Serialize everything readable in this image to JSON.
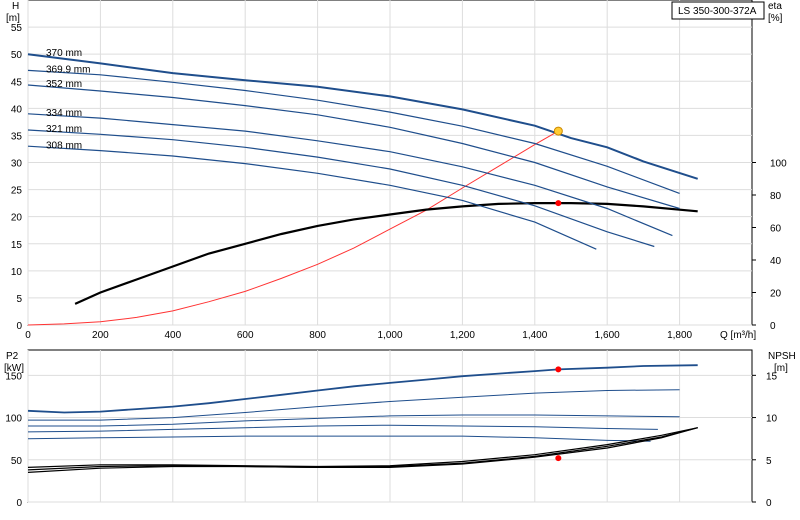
{
  "chart_data": [
    {
      "type": "line",
      "model_label": "LS 350-300-372A",
      "ylabel_left": "H",
      "ylabel_left_unit": "[m]",
      "ylabel_right": "eta",
      "ylabel_right_unit": "[%]",
      "xlabel": "Q [m³/h]",
      "xlim": [
        0,
        2000
      ],
      "ylim_left": [
        0,
        60
      ],
      "ylim_right": [
        0,
        200
      ],
      "x_ticks": [
        0,
        200,
        400,
        600,
        800,
        1000,
        1200,
        1400,
        1600,
        1800
      ],
      "x_tick_labels": [
        "0",
        "200",
        "400",
        "600",
        "800",
        "1,000",
        "1,200",
        "1,400",
        "1,600",
        "1,800"
      ],
      "y_ticks_left": [
        0,
        5,
        10,
        15,
        20,
        25,
        30,
        35,
        40,
        45,
        50,
        55
      ],
      "y_ticks_right": [
        0,
        20,
        40,
        60,
        80,
        100
      ],
      "grid": true,
      "colors": {
        "head": "#1f4e8c",
        "efficiency": "#000000",
        "system": "#ff3333",
        "operating_point_head": "#ffcc33",
        "operating_point": "#ff0000",
        "grid": "#dddddd"
      },
      "head_curves": [
        {
          "label": "370 mm",
          "x": [
            0,
            200,
            400,
            600,
            800,
            1000,
            1200,
            1400,
            1500,
            1600,
            1700,
            1850
          ],
          "y": [
            50,
            48.3,
            46.5,
            45.2,
            44,
            42.2,
            39.8,
            36.8,
            34.5,
            32.8,
            30.2,
            27
          ]
        },
        {
          "label": "369.9 mm",
          "x": [
            0,
            200,
            400,
            600,
            800,
            1000,
            1200,
            1400,
            1600,
            1800
          ],
          "y": [
            47,
            46.2,
            44.8,
            43.3,
            41.5,
            39.3,
            36.7,
            33.5,
            29.3,
            24.3
          ]
        },
        {
          "label": "352 mm",
          "x": [
            0,
            200,
            400,
            600,
            800,
            1000,
            1200,
            1400,
            1600,
            1800
          ],
          "y": [
            44.3,
            43.2,
            42,
            40.5,
            38.8,
            36.5,
            33.5,
            30,
            25.5,
            21.5
          ]
        },
        {
          "label": "334 mm",
          "x": [
            0,
            200,
            400,
            600,
            800,
            1000,
            1200,
            1400,
            1600,
            1780
          ],
          "y": [
            39,
            38.2,
            37,
            35.8,
            34,
            32,
            29.2,
            25.8,
            21.5,
            16.5
          ]
        },
        {
          "label": "321 mm",
          "x": [
            0,
            200,
            400,
            600,
            800,
            1000,
            1200,
            1400,
            1600,
            1730
          ],
          "y": [
            36,
            35.2,
            34.2,
            32.8,
            31,
            28.8,
            25.8,
            22,
            17.2,
            14.5
          ]
        },
        {
          "label": "308 mm",
          "x": [
            0,
            200,
            400,
            600,
            800,
            1000,
            1200,
            1400,
            1570
          ],
          "y": [
            33,
            32.2,
            31.2,
            29.8,
            28,
            25.8,
            23,
            19,
            14
          ]
        }
      ],
      "efficiency_curve": {
        "x": [
          130,
          200,
          300,
          400,
          500,
          600,
          700,
          800,
          900,
          1000,
          1100,
          1200,
          1300,
          1400,
          1500,
          1600,
          1700,
          1850
        ],
        "y": [
          13,
          20,
          28,
          36,
          44,
          50,
          56,
          61,
          65,
          68,
          71,
          73,
          74.5,
          75,
          75,
          74.5,
          73,
          70
        ]
      },
      "system_curve": {
        "x": [
          0,
          100,
          200,
          300,
          400,
          500,
          600,
          700,
          800,
          900,
          1000,
          1100,
          1200,
          1300,
          1400,
          1465
        ],
        "y": [
          0,
          0.2,
          0.6,
          1.4,
          2.6,
          4.3,
          6.2,
          8.6,
          11.2,
          14.2,
          17.7,
          21.2,
          25.3,
          29.3,
          33.3,
          35.8
        ]
      },
      "operating_point_head": {
        "x": 1465,
        "y": 35.8
      },
      "operating_point_eta": {
        "x": 1465,
        "y": 75
      }
    },
    {
      "type": "line",
      "ylabel_left": "P2",
      "ylabel_left_unit": "[kW]",
      "ylabel_right": "NPSH",
      "ylabel_right_unit": "[m]",
      "xlim": [
        0,
        2000
      ],
      "ylim_left": [
        0,
        180
      ],
      "ylim_right": [
        0,
        18
      ],
      "y_ticks_left": [
        0,
        50,
        100,
        150
      ],
      "y_ticks_right": [
        0,
        5,
        10,
        15
      ],
      "grid": true,
      "power_curves": [
        {
          "x": [
            0,
            100,
            200,
            300,
            400,
            500,
            600,
            700,
            800,
            900,
            1000,
            1100,
            1200,
            1300,
            1400,
            1465,
            1600,
            1700,
            1850
          ],
          "y": [
            108,
            106,
            107,
            110,
            113,
            117,
            122,
            127,
            132,
            137,
            141,
            145,
            149,
            152,
            155,
            157,
            159,
            161,
            162
          ]
        },
        {
          "x": [
            0,
            200,
            400,
            600,
            800,
            1000,
            1200,
            1400,
            1600,
            1800
          ],
          "y": [
            97,
            97,
            100,
            106,
            113,
            119,
            124,
            129,
            132,
            133
          ]
        },
        {
          "x": [
            0,
            200,
            400,
            600,
            800,
            1000,
            1200,
            1400,
            1600,
            1800
          ],
          "y": [
            90,
            90,
            92,
            96,
            99,
            102,
            103,
            103,
            102,
            101
          ]
        },
        {
          "x": [
            0,
            200,
            400,
            600,
            800,
            1000,
            1200,
            1400,
            1600,
            1740
          ],
          "y": [
            83,
            84,
            86,
            88,
            90,
            91,
            90,
            89,
            87,
            86
          ]
        },
        {
          "x": [
            0,
            200,
            400,
            600,
            800,
            1000,
            1200,
            1400,
            1600,
            1720
          ],
          "y": [
            75,
            76,
            77,
            78,
            78,
            78,
            78,
            76,
            73,
            72
          ]
        }
      ],
      "npsh_curves": [
        {
          "x": [
            0,
            200,
            400,
            600,
            800,
            1000,
            1200,
            1400,
            1600,
            1750,
            1850
          ],
          "y": [
            3.5,
            4,
            4.2,
            4.2,
            4.1,
            4.1,
            4.5,
            5.3,
            6.4,
            7.6,
            8.8
          ]
        },
        {
          "x": [
            0,
            200,
            400,
            600,
            800,
            1000,
            1200,
            1400,
            1600,
            1750,
            1850
          ],
          "y": [
            3.8,
            4.2,
            4.3,
            4.2,
            4.1,
            4.2,
            4.6,
            5.4,
            6.6,
            7.7,
            8.8
          ]
        },
        {
          "x": [
            0,
            200,
            400,
            600,
            800,
            1000,
            1200,
            1400,
            1600,
            1750,
            1850
          ],
          "y": [
            4.1,
            4.4,
            4.4,
            4.3,
            4.2,
            4.3,
            4.8,
            5.6,
            6.8,
            7.9,
            8.8
          ]
        }
      ],
      "operating_point_power": {
        "x": 1465,
        "y": 157
      },
      "operating_point_npsh": {
        "x": 1465,
        "y": 5.2
      }
    }
  ]
}
